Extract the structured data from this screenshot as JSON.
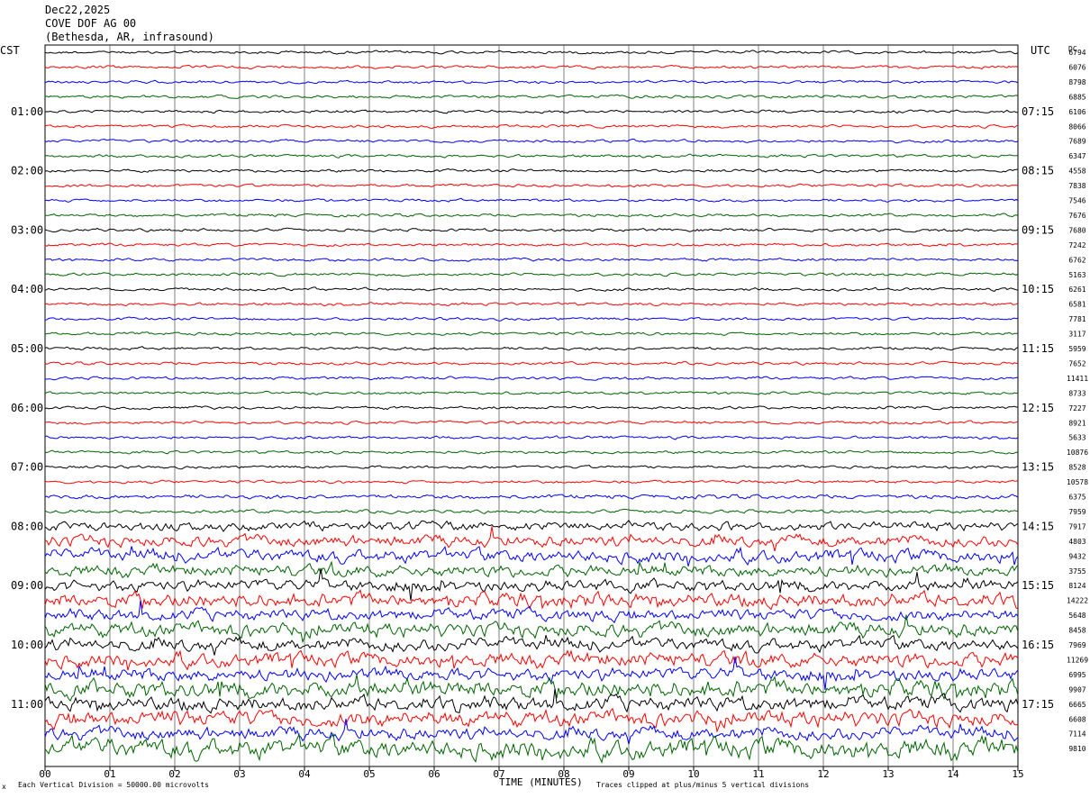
{
  "header": {
    "date": "Dec22,2025",
    "station": "COVE DOF AG 00",
    "location": "(Bethesda, AR, infrasound)"
  },
  "left_tz": "CST",
  "right_tz": "UTC",
  "dc_label": "DC",
  "footer": {
    "scale": "Each Vertical Division = 50000.00 microvolts",
    "clip": "Traces clipped at plus/minus 5 vertical divisions",
    "corner": "x"
  },
  "chart_data": {
    "type": "line",
    "title": "",
    "xlabel": "TIME (MINUTES)",
    "xlim": [
      0,
      15
    ],
    "x_ticks": [
      "00",
      "01",
      "02",
      "03",
      "04",
      "05",
      "06",
      "07",
      "08",
      "09",
      "10",
      "11",
      "12",
      "13",
      "14",
      "15"
    ],
    "left_hour_labels": [
      "01:00",
      "02:00",
      "03:00",
      "04:00",
      "05:00",
      "06:00",
      "07:00",
      "08:00",
      "09:00",
      "10:00",
      "11:00"
    ],
    "right_hour_labels": [
      "07:15",
      "08:15",
      "09:15",
      "10:15",
      "11:15",
      "12:15",
      "13:15",
      "14:15",
      "15:15",
      "16:15",
      "17:15"
    ],
    "trace_colors": [
      "#000000",
      "#ff0000",
      "#0000ff",
      "#006400"
    ],
    "dc_offsets": [
      "6794",
      "6076",
      "8798",
      "6885",
      "6106",
      "8066",
      "7689",
      "6347",
      "4558",
      "7838",
      "7546",
      "7676",
      "7680",
      "7242",
      "6762",
      "5163",
      "6261",
      "6581",
      "7781",
      "3117",
      "5959",
      "7652",
      "11411",
      "8733",
      "7227",
      "8921",
      "5633",
      "10876",
      "8528",
      "10578",
      "6375",
      "7959",
      "7917",
      "4803",
      "9432",
      "3755",
      "8124",
      "14222",
      "5648",
      "8458",
      "7969",
      "11269",
      "6995",
      "9907",
      "6665",
      "6608",
      "7114",
      "9810"
    ],
    "trace_activity": [
      1,
      1,
      1,
      1,
      1,
      1,
      1,
      1,
      1,
      1,
      1,
      1,
      1,
      1,
      1,
      1,
      1,
      1,
      1,
      1,
      1,
      1,
      1,
      1,
      1,
      1,
      1,
      1,
      1,
      1,
      1.4,
      1.2,
      3,
      4,
      4.5,
      4,
      4,
      5,
      4,
      5,
      4.5,
      5,
      4.5,
      6,
      5,
      5.5,
      4.5,
      7
    ]
  }
}
